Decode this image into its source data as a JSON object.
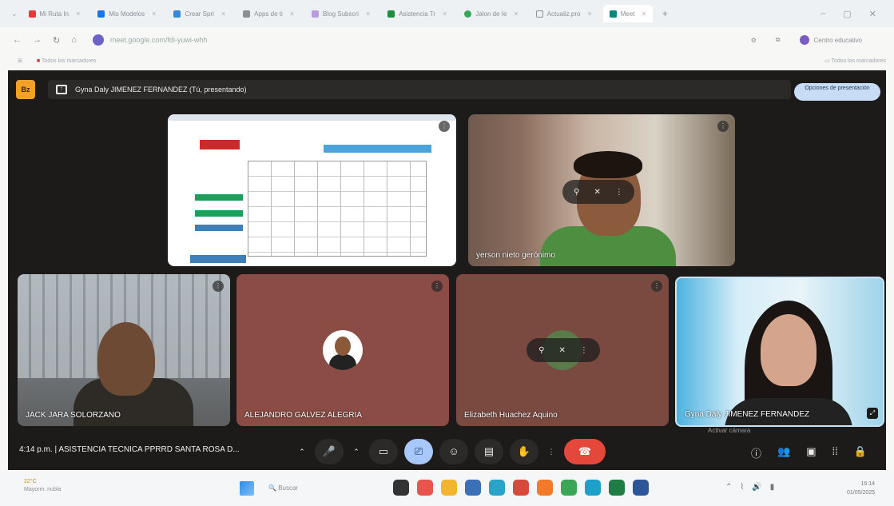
{
  "browser": {
    "tabs": [
      {
        "label": "Mi Ruta In",
        "icon": "youtube-icon",
        "color": "#e53935"
      },
      {
        "label": "Mis Modelos",
        "icon": "drive-icon",
        "color": "#1a73e8"
      },
      {
        "label": "Crear Spri",
        "icon": "spiral-icon",
        "color": "#3a86d9"
      },
      {
        "label": "Apps de ti",
        "icon": "code-icon",
        "color": "#8a8f96"
      },
      {
        "label": "Blog Subscri",
        "icon": "spark-icon",
        "color": "#b89be0"
      },
      {
        "label": "Asistencia Tr",
        "icon": "sheets-icon",
        "color": "#1e8e3e"
      },
      {
        "label": "Jalon de Ie",
        "icon": "circle-icon",
        "color": "#34a853"
      },
      {
        "label": "Actualiz.pro",
        "icon": "page-icon",
        "color": "#8a8f96"
      },
      {
        "label": "Meet",
        "icon": "meet-icon",
        "color": "#00897b"
      }
    ],
    "new_tab": "+",
    "url": "meet.google.com/fdi-yuwi-whh",
    "profile_label": "Centro educativo",
    "bookmark_left": "Todos los marcadores",
    "bookmark_right": "Todos los marcadores"
  },
  "meet": {
    "logo_text": "Bz",
    "presenting_text": "Gyna Daly JIMENEZ FERNANDEZ (Tú, presentando)",
    "presentation_options": "Opciones de presentación",
    "tiles": [
      {
        "name": "",
        "kind": "screen-share"
      },
      {
        "name": "yerson nieto gerónimo",
        "kind": "camera"
      },
      {
        "name": "JACK JARA SOLORZANO",
        "kind": "camera"
      },
      {
        "name": "ALEJANDRO GALVEZ ALEGRIA",
        "kind": "avatar"
      },
      {
        "name": "Elizabeth Huachez Aquino",
        "kind": "avatar"
      },
      {
        "name": "Gyna Daly JIMENEZ FERNANDEZ",
        "kind": "camera"
      }
    ],
    "time": "4:14 p.m.",
    "meeting_title": "ASISTENCIA TECNICA PPRRD SANTA ROSA D...",
    "overlay_label": "Activar cámara"
  },
  "taskbar": {
    "weather_temp": "22°C",
    "weather_desc": "Mayorm. nubla",
    "search_placeholder": "Buscar",
    "time": "16:14",
    "date": "01/05/2025"
  },
  "colors": {
    "meet_bg": "#1d1b1a",
    "accent": "#a8c7fa",
    "end_call": "#e5483b",
    "logo": "#f2a12b"
  }
}
